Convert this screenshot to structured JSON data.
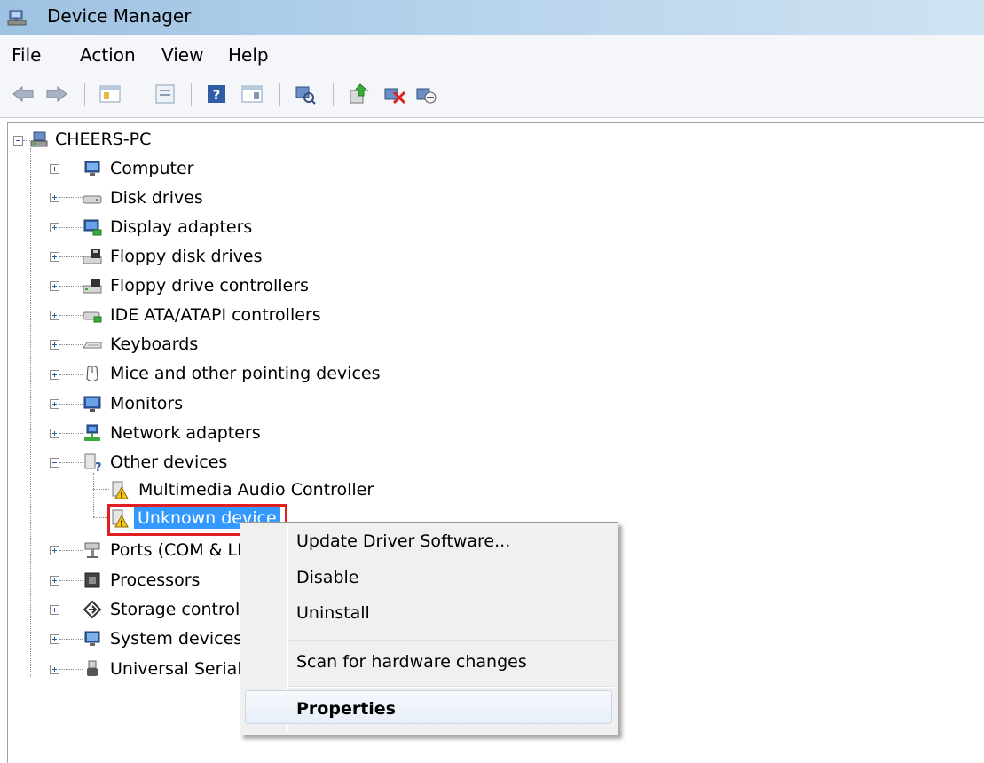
{
  "window": {
    "title": "Device Manager"
  },
  "menu": [
    "File",
    "Action",
    "View",
    "Help"
  ],
  "toolbar": {
    "icons": [
      "back-arrow-icon",
      "forward-arrow-icon",
      "console-tree-icon",
      "properties-icon",
      "help-icon",
      "action-pane-icon",
      "scan-hardware-icon",
      "update-driver-icon",
      "uninstall-icon",
      "disable-icon"
    ]
  },
  "tree": {
    "root": "CHEERS-PC",
    "categories": [
      {
        "label": "Computer",
        "icon": "computer-icon"
      },
      {
        "label": "Disk drives",
        "icon": "disk-drive-icon"
      },
      {
        "label": "Display adapters",
        "icon": "display-adapter-icon"
      },
      {
        "label": "Floppy disk drives",
        "icon": "floppy-disk-icon"
      },
      {
        "label": "Floppy drive controllers",
        "icon": "floppy-controller-icon"
      },
      {
        "label": "IDE ATA/ATAPI controllers",
        "icon": "ide-controller-icon"
      },
      {
        "label": "Keyboards",
        "icon": "keyboard-icon"
      },
      {
        "label": "Mice and other pointing devices",
        "icon": "mouse-icon"
      },
      {
        "label": "Monitors",
        "icon": "monitor-icon"
      },
      {
        "label": "Network adapters",
        "icon": "network-adapter-icon"
      },
      {
        "label": "Other devices",
        "icon": "other-devices-icon",
        "expanded": true
      }
    ],
    "other_devices_children": [
      {
        "label": "Multimedia Audio Controller",
        "icon": "warning-device-icon"
      },
      {
        "label": "Unknown device",
        "icon": "warning-device-icon",
        "selected": true
      }
    ],
    "categories_after": [
      {
        "label": "Ports (COM & LPT)",
        "icon": "port-icon"
      },
      {
        "label": "Processors",
        "icon": "processor-icon"
      },
      {
        "label": "Storage controllers",
        "icon": "storage-controller-icon"
      },
      {
        "label": "System devices",
        "icon": "system-devices-icon"
      },
      {
        "label": "Universal Serial Bus controllers",
        "icon": "usb-icon"
      }
    ]
  },
  "context_menu": {
    "update": "Update Driver Software...",
    "disable": "Disable",
    "uninstall": "Uninstall",
    "scan": "Scan for hardware changes",
    "properties": "Properties"
  },
  "colors": {
    "selection": "#3399ff",
    "highlight_box": "#e02020"
  }
}
